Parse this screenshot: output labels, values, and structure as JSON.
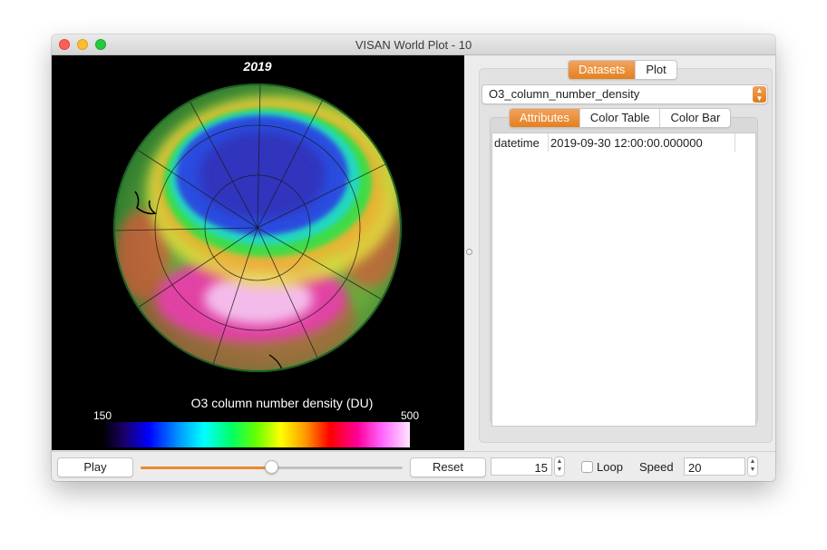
{
  "window": {
    "title": "VISAN World Plot - 10"
  },
  "plot": {
    "year_label": "2019",
    "colorbar": {
      "title": "O3 column number density (DU)",
      "min_label": "150",
      "max_label": "500"
    }
  },
  "tabs": {
    "items": [
      "Datasets",
      "Plot"
    ],
    "active": "Datasets"
  },
  "dataset_select": {
    "value": "O3_column_number_density"
  },
  "subtabs": {
    "items": [
      "Attributes",
      "Color Table",
      "Color Bar"
    ],
    "active": "Attributes"
  },
  "attributes": [
    {
      "name": "datetime",
      "value": "2019-09-30 12:00:00.000000"
    }
  ],
  "controls": {
    "play_label": "Play",
    "reset_label": "Reset",
    "frame_value": "15",
    "slider_fraction": 0.5,
    "loop_label": "Loop",
    "loop_checked": false,
    "speed_label": "Speed",
    "speed_value": "20"
  },
  "colors": {
    "accent": "#e98a2e",
    "plot_background": "#000000"
  },
  "icons": [
    "close-window-icon",
    "minimize-window-icon",
    "zoom-window-icon",
    "updown-arrows-icon"
  ]
}
